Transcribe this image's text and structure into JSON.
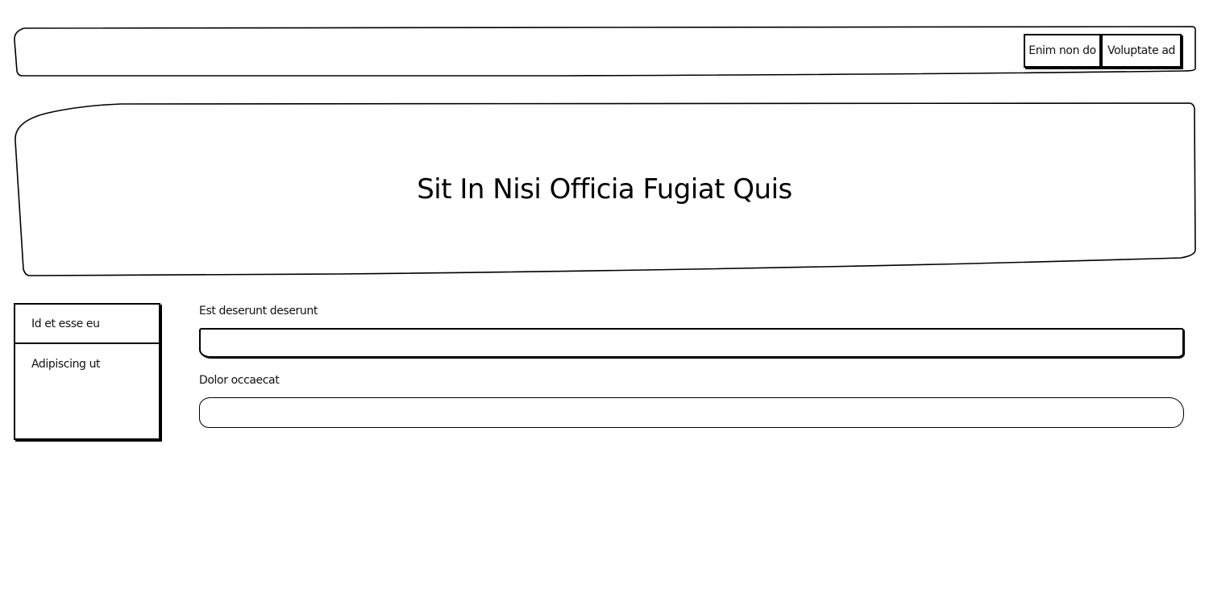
{
  "header": {
    "actions": [
      {
        "label": "Enim non do"
      },
      {
        "label": "Voluptate ad"
      }
    ]
  },
  "hero": {
    "title": "Sit In Nisi Officia Fugiat Quis"
  },
  "side_menu": {
    "items": [
      {
        "label": "Id et esse eu"
      },
      {
        "label": "Adipiscing ut"
      }
    ]
  },
  "form": {
    "fields": [
      {
        "label": "Est deserunt deserunt",
        "value": ""
      },
      {
        "label": "Dolor occaecat",
        "value": ""
      }
    ]
  }
}
